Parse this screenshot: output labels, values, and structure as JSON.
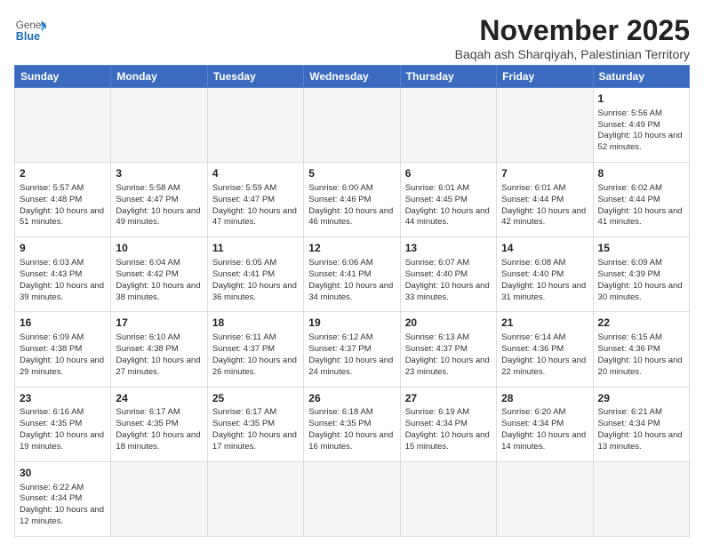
{
  "logo": {
    "line1": "General",
    "line2": "Blue"
  },
  "title": "November 2025",
  "subtitle": "Baqah ash Sharqiyah, Palestinian Territory",
  "weekdays": [
    "Sunday",
    "Monday",
    "Tuesday",
    "Wednesday",
    "Thursday",
    "Friday",
    "Saturday"
  ],
  "days": [
    {
      "num": "",
      "info": ""
    },
    {
      "num": "",
      "info": ""
    },
    {
      "num": "",
      "info": ""
    },
    {
      "num": "",
      "info": ""
    },
    {
      "num": "",
      "info": ""
    },
    {
      "num": "",
      "info": ""
    },
    {
      "num": "1",
      "info": "Sunrise: 5:56 AM\nSunset: 4:49 PM\nDaylight: 10 hours\nand 52 minutes."
    },
    {
      "num": "2",
      "info": "Sunrise: 5:57 AM\nSunset: 4:48 PM\nDaylight: 10 hours\nand 51 minutes."
    },
    {
      "num": "3",
      "info": "Sunrise: 5:58 AM\nSunset: 4:47 PM\nDaylight: 10 hours\nand 49 minutes."
    },
    {
      "num": "4",
      "info": "Sunrise: 5:59 AM\nSunset: 4:47 PM\nDaylight: 10 hours\nand 47 minutes."
    },
    {
      "num": "5",
      "info": "Sunrise: 6:00 AM\nSunset: 4:46 PM\nDaylight: 10 hours\nand 46 minutes."
    },
    {
      "num": "6",
      "info": "Sunrise: 6:01 AM\nSunset: 4:45 PM\nDaylight: 10 hours\nand 44 minutes."
    },
    {
      "num": "7",
      "info": "Sunrise: 6:01 AM\nSunset: 4:44 PM\nDaylight: 10 hours\nand 42 minutes."
    },
    {
      "num": "8",
      "info": "Sunrise: 6:02 AM\nSunset: 4:44 PM\nDaylight: 10 hours\nand 41 minutes."
    },
    {
      "num": "9",
      "info": "Sunrise: 6:03 AM\nSunset: 4:43 PM\nDaylight: 10 hours\nand 39 minutes."
    },
    {
      "num": "10",
      "info": "Sunrise: 6:04 AM\nSunset: 4:42 PM\nDaylight: 10 hours\nand 38 minutes."
    },
    {
      "num": "11",
      "info": "Sunrise: 6:05 AM\nSunset: 4:41 PM\nDaylight: 10 hours\nand 36 minutes."
    },
    {
      "num": "12",
      "info": "Sunrise: 6:06 AM\nSunset: 4:41 PM\nDaylight: 10 hours\nand 34 minutes."
    },
    {
      "num": "13",
      "info": "Sunrise: 6:07 AM\nSunset: 4:40 PM\nDaylight: 10 hours\nand 33 minutes."
    },
    {
      "num": "14",
      "info": "Sunrise: 6:08 AM\nSunset: 4:40 PM\nDaylight: 10 hours\nand 31 minutes."
    },
    {
      "num": "15",
      "info": "Sunrise: 6:09 AM\nSunset: 4:39 PM\nDaylight: 10 hours\nand 30 minutes."
    },
    {
      "num": "16",
      "info": "Sunrise: 6:09 AM\nSunset: 4:38 PM\nDaylight: 10 hours\nand 29 minutes."
    },
    {
      "num": "17",
      "info": "Sunrise: 6:10 AM\nSunset: 4:38 PM\nDaylight: 10 hours\nand 27 minutes."
    },
    {
      "num": "18",
      "info": "Sunrise: 6:11 AM\nSunset: 4:37 PM\nDaylight: 10 hours\nand 26 minutes."
    },
    {
      "num": "19",
      "info": "Sunrise: 6:12 AM\nSunset: 4:37 PM\nDaylight: 10 hours\nand 24 minutes."
    },
    {
      "num": "20",
      "info": "Sunrise: 6:13 AM\nSunset: 4:37 PM\nDaylight: 10 hours\nand 23 minutes."
    },
    {
      "num": "21",
      "info": "Sunrise: 6:14 AM\nSunset: 4:36 PM\nDaylight: 10 hours\nand 22 minutes."
    },
    {
      "num": "22",
      "info": "Sunrise: 6:15 AM\nSunset: 4:36 PM\nDaylight: 10 hours\nand 20 minutes."
    },
    {
      "num": "23",
      "info": "Sunrise: 6:16 AM\nSunset: 4:35 PM\nDaylight: 10 hours\nand 19 minutes."
    },
    {
      "num": "24",
      "info": "Sunrise: 6:17 AM\nSunset: 4:35 PM\nDaylight: 10 hours\nand 18 minutes."
    },
    {
      "num": "25",
      "info": "Sunrise: 6:17 AM\nSunset: 4:35 PM\nDaylight: 10 hours\nand 17 minutes."
    },
    {
      "num": "26",
      "info": "Sunrise: 6:18 AM\nSunset: 4:35 PM\nDaylight: 10 hours\nand 16 minutes."
    },
    {
      "num": "27",
      "info": "Sunrise: 6:19 AM\nSunset: 4:34 PM\nDaylight: 10 hours\nand 15 minutes."
    },
    {
      "num": "28",
      "info": "Sunrise: 6:20 AM\nSunset: 4:34 PM\nDaylight: 10 hours\nand 14 minutes."
    },
    {
      "num": "29",
      "info": "Sunrise: 6:21 AM\nSunset: 4:34 PM\nDaylight: 10 hours\nand 13 minutes."
    },
    {
      "num": "30",
      "info": "Sunrise: 6:22 AM\nSunset: 4:34 PM\nDaylight: 10 hours\nand 12 minutes."
    }
  ]
}
